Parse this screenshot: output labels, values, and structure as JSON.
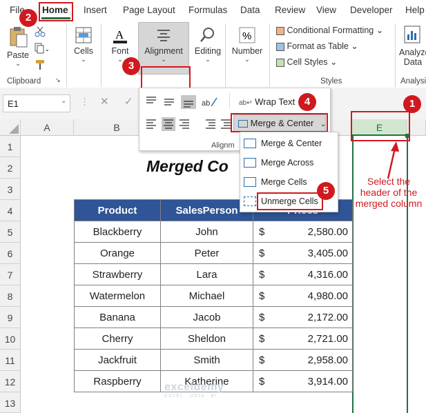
{
  "ribbon_tabs": [
    "File",
    "Home",
    "Insert",
    "Page Layout",
    "Formulas",
    "Data",
    "Review",
    "View",
    "Developer",
    "Help"
  ],
  "ribbon": {
    "clipboard": {
      "paste": "Paste",
      "group": "Clipboard"
    },
    "cells": "Cells",
    "font": "Font",
    "alignment": "Alignment",
    "editing": "Editing",
    "number": "Number",
    "conditional_formatting": "Conditional Formatting",
    "format_as_table": "Format as Table",
    "cell_styles": "Cell Styles",
    "styles_group": "Styles",
    "analyze": "Analyze",
    "analyze2": "Data",
    "analysis_group": "Analysis"
  },
  "alignment_panel": {
    "wrap_text": "Wrap Text",
    "merge_center": "Merge & Center",
    "group_label": "Alignm"
  },
  "merge_menu": [
    "Merge & Center",
    "Merge Across",
    "Merge Cells",
    "Unmerge Cells"
  ],
  "formula_bar": {
    "name_box": "E1"
  },
  "columns": [
    "A",
    "B",
    "E"
  ],
  "rows": [
    "1",
    "2",
    "3",
    "4",
    "5",
    "6",
    "7",
    "8",
    "9",
    "10",
    "11",
    "12",
    "13"
  ],
  "sheet_title": "Merged Co",
  "table": {
    "headers": [
      "Product",
      "SalesPerson",
      "Prices"
    ],
    "currency": "$",
    "rows": [
      {
        "product": "Blackberry",
        "person": "John",
        "price": "2,580.00"
      },
      {
        "product": "Orange",
        "person": "Peter",
        "price": "3,405.00"
      },
      {
        "product": "Strawberry",
        "person": "Lara",
        "price": "4,316.00"
      },
      {
        "product": "Watermelon",
        "person": "Michael",
        "price": "4,980.00"
      },
      {
        "product": "Banana",
        "person": "Jacob",
        "price": "2,172.00"
      },
      {
        "product": "Cherry",
        "person": "Sheldon",
        "price": "2,721.00"
      },
      {
        "product": "Jackfruit",
        "person": "Smith",
        "price": "2,958.00"
      },
      {
        "product": "Raspberry",
        "person": "Katherine",
        "price": "3,914.00"
      }
    ]
  },
  "annotation": "Select the header of the merged column",
  "badges": [
    "1",
    "2",
    "3",
    "4",
    "5"
  ],
  "watermark": "exceldemy",
  "watermark_sub": "EXCEL · DATA · BI",
  "colors": {
    "accent_red": "#d0191f",
    "excel_green": "#1e7145",
    "header_blue": "#2f5597",
    "selected_col": "#e2efda"
  }
}
